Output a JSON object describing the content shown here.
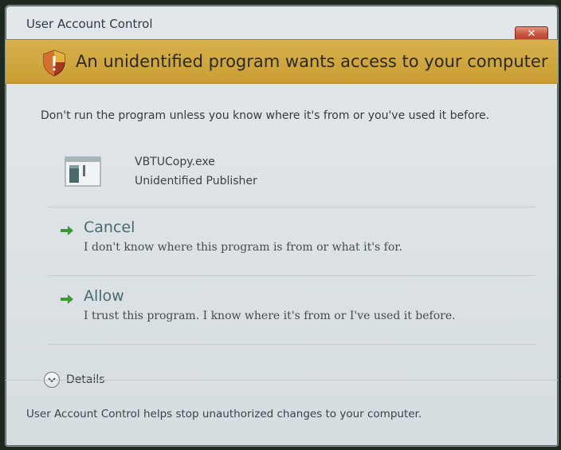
{
  "window": {
    "title": "User Account Control",
    "close_label": "✕"
  },
  "banner": {
    "text": "An unidentified program wants access to your computer",
    "color": "#cfa63f"
  },
  "main": {
    "warning": "Don't run the program unless you know where it's from or you've used it before.",
    "program": {
      "name": "VBTUCopy.exe",
      "publisher": "Unidentified Publisher"
    },
    "options": [
      {
        "title": "Cancel",
        "description": "I don't know where this program is from or what it's for.",
        "icon": "green-arrow-icon"
      },
      {
        "title": "Allow",
        "description": "I trust this program. I know where it's from or I've used it before.",
        "icon": "green-arrow-icon"
      }
    ],
    "details_label": "Details"
  },
  "footer": {
    "text": "User Account Control helps stop unauthorized changes to your computer."
  },
  "colors": {
    "arrow": "#3a9a2e",
    "close": "#c8553f"
  }
}
